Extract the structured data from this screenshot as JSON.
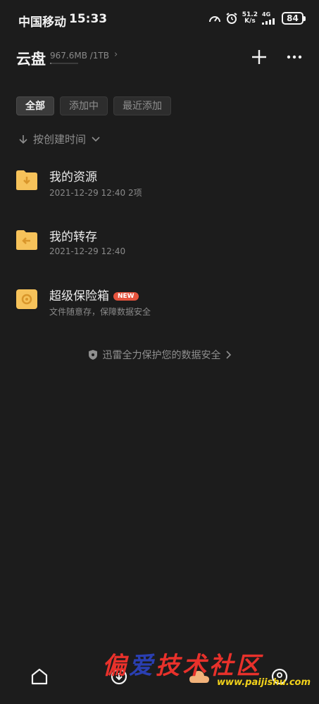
{
  "status_bar": {
    "carrier": "中国移动",
    "time": "15:33",
    "speed_value": "51.2",
    "speed_unit": "K/s",
    "network": "4G",
    "battery": "84"
  },
  "header": {
    "title": "云盘",
    "storage": "967.6MB /1TB",
    "storage_used_fraction": 0.0009,
    "chevron": "›"
  },
  "filters": [
    {
      "label": "全部",
      "active": true
    },
    {
      "label": "添加中",
      "active": false
    },
    {
      "label": "最近添加",
      "active": false
    }
  ],
  "sort": {
    "label": "按创建时间"
  },
  "items": [
    {
      "name": "我的资源",
      "meta": "2021-12-29 12:40 2项",
      "icon": "download-folder-icon"
    },
    {
      "name": "我的转存",
      "meta": "2021-12-29 12:40",
      "icon": "transfer-folder-icon"
    },
    {
      "name": "超级保险箱",
      "badge": "NEW",
      "meta": "文件随意存，保障数据安全",
      "icon": "safe-icon"
    }
  ],
  "security_note": "迅雷全力保护您的数据安全",
  "watermark": {
    "text_a": "偏",
    "text_b": "爱",
    "text_c": "技术社区",
    "url": "www.paijishu.com"
  },
  "colors": {
    "background": "#1c1c1c",
    "folder_yellow": "#f6c25a",
    "badge_red": "#e5533d"
  }
}
